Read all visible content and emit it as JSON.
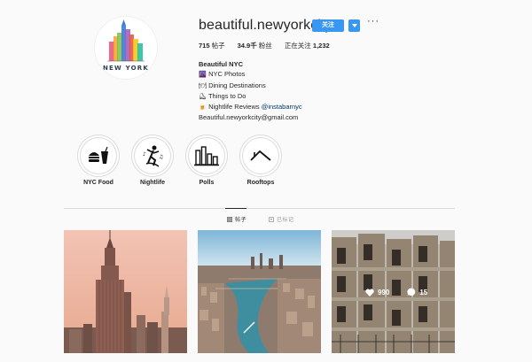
{
  "profile": {
    "username": "beautiful.newyorkcity",
    "follow_label": "关注",
    "more_label": "···",
    "avatar_text": "NEW YORK"
  },
  "stats": [
    {
      "value": "715",
      "label": " 帖子"
    },
    {
      "value": "34.9千",
      "label": " 粉丝"
    },
    {
      "value": "1,232",
      "label": "正在关注 "
    }
  ],
  "bio": {
    "name": "Beautiful NYC",
    "lines": [
      {
        "emoji": "🌆",
        "text": "NYC Photos"
      },
      {
        "emoji": "🍽",
        "text": "Dining Destinations"
      },
      {
        "emoji": "⛸",
        "text": "Things to Do"
      },
      {
        "emoji": "🍺",
        "text": "Nightlife Reviews ",
        "link": "@instabarnyc"
      }
    ],
    "email": "Beautiful.newyorkcity@gmail.com"
  },
  "highlights": [
    {
      "label": "NYC Food",
      "icon": "burger-soda-icon"
    },
    {
      "label": "Nightlife",
      "icon": "dancer-icon"
    },
    {
      "label": "Polls",
      "icon": "bar-chart-icon"
    },
    {
      "label": "Rooftops",
      "icon": "rooftop-icon"
    }
  ],
  "tabs": {
    "posts_label": "帖子",
    "tagged_label": "已标记"
  },
  "posts": [
    {
      "subject": "empire-state-building"
    },
    {
      "subject": "manhattan-aerial"
    },
    {
      "subject": "brownstones",
      "likes": "990",
      "comments": "15"
    }
  ],
  "colors": {
    "accent": "#3897f0",
    "text": "#262626",
    "muted": "#999999",
    "border": "#dbdbdb",
    "link": "#003569"
  }
}
